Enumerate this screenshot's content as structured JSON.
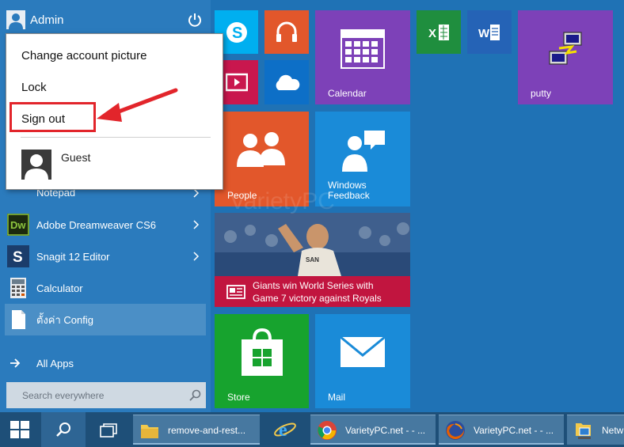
{
  "user": {
    "name": "Admin"
  },
  "context_menu": {
    "items": [
      "Change account picture",
      "Lock",
      "Sign out"
    ],
    "other_user": "Guest"
  },
  "apps": [
    {
      "label": "Notepad",
      "icon": "notepad-icon",
      "has_submenu": true
    },
    {
      "label": "Adobe Dreamweaver CS6",
      "icon": "dreamweaver-icon",
      "has_submenu": true
    },
    {
      "label": "Snagit 12 Editor",
      "icon": "snagit-icon",
      "has_submenu": true
    },
    {
      "label": "Calculator",
      "icon": "calculator-icon",
      "has_submenu": false
    },
    {
      "label": "ตั้งค่า Config",
      "icon": "document-icon",
      "has_submenu": false
    }
  ],
  "all_apps_label": "All Apps",
  "search": {
    "placeholder": "Search everywhere"
  },
  "tiles": {
    "calendar": "Calendar",
    "putty": "putty",
    "people": "People",
    "feedback": "Windows Feedback",
    "news_headline_1": "Giants win World Series with",
    "news_headline_2": "Game 7 victory against Royals",
    "store": "Store",
    "mail": "Mail"
  },
  "taskbar": {
    "tasks": [
      {
        "label": "remove-and-rest...",
        "icon": "folder-icon"
      },
      {
        "label": "VarietyPC.net - - ...",
        "icon": "chrome-icon"
      },
      {
        "label": "VarietyPC.net - - ...",
        "icon": "firefox-icon"
      },
      {
        "label": "Netw",
        "icon": "network-icon"
      }
    ]
  },
  "watermark": "VarietyPC",
  "colors": {
    "start_bg": "#2b7bbd",
    "accent_red": "#e2252b",
    "taskbar": "#1e4f78"
  }
}
